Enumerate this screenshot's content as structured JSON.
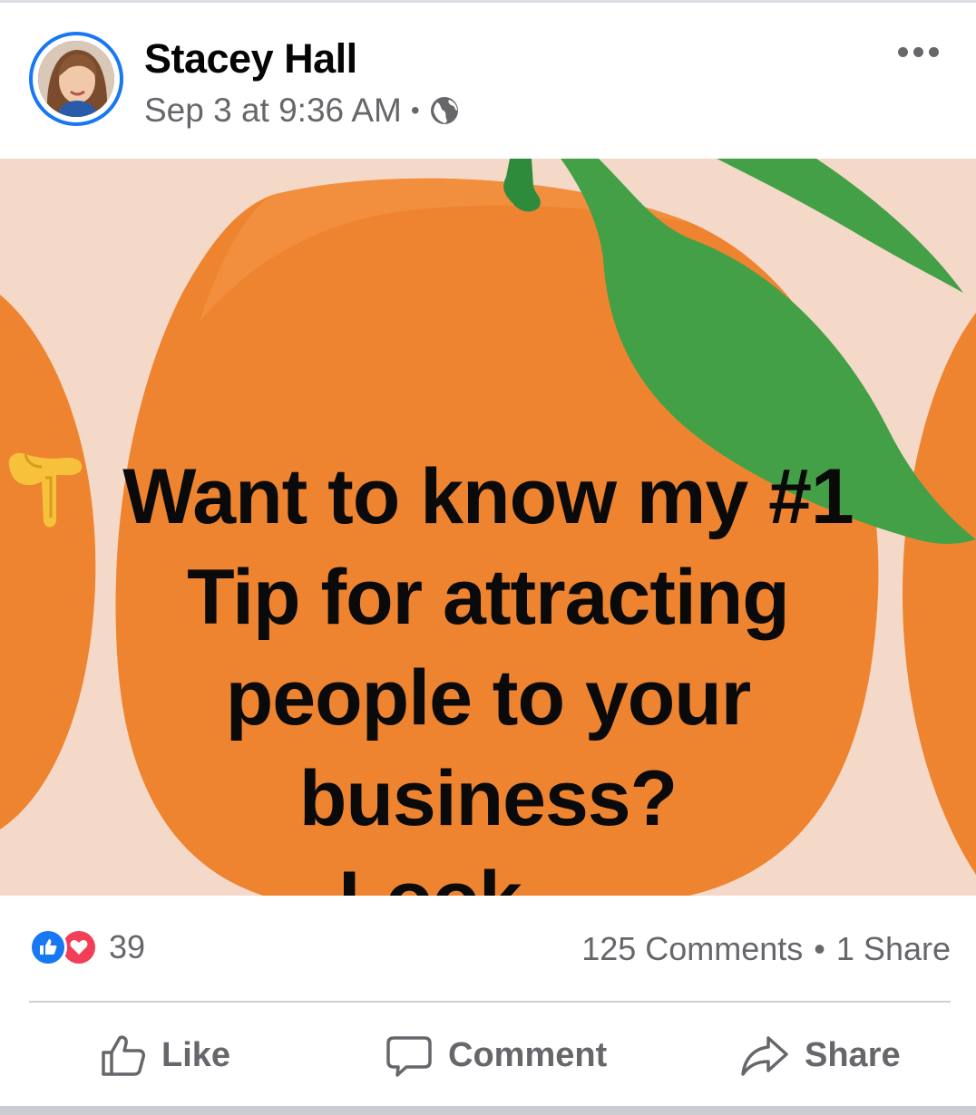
{
  "post": {
    "author": "Stacey Hall",
    "timestamp": "Sep 3 at 9:36 AM",
    "separator": "•",
    "audience_icon": "globe-icon",
    "more_icon": "more-options-icon"
  },
  "image": {
    "text_lines": [
      "Want to know my #1",
      "Tip for attracting",
      "people to your",
      "business?"
    ],
    "last_line": "Look",
    "pointing_icon": "backhand-index-pointing-down",
    "colors": {
      "background": "#f5d9c8",
      "orange": "#ef8430",
      "leaf": "#43a047"
    }
  },
  "stats": {
    "reaction_count": "39",
    "comments": "125 Comments",
    "separator": "•",
    "shares": "1 Share",
    "reaction_icons": [
      "like-icon",
      "love-icon"
    ]
  },
  "actions": {
    "like": "Like",
    "comment": "Comment",
    "share": "Share"
  },
  "colors": {
    "accent": "#1877f2",
    "love": "#f33e58",
    "muted_text": "#65676b"
  }
}
